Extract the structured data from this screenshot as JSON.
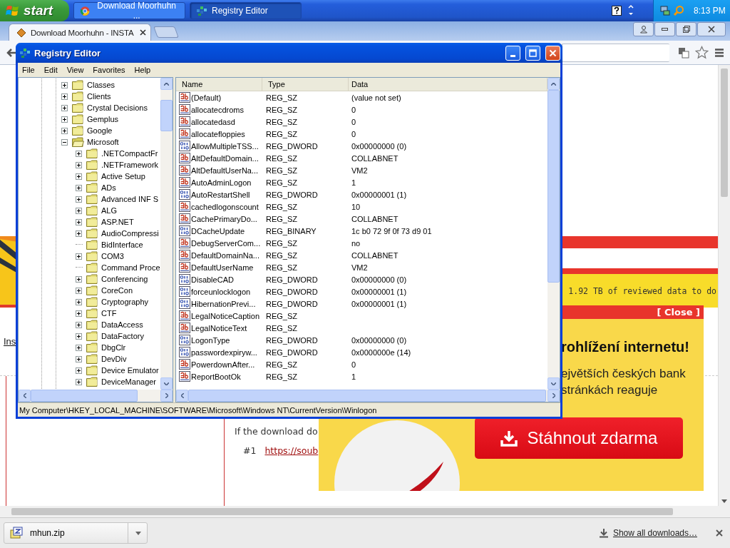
{
  "taskbar": {
    "start_label": "start",
    "tasks": [
      {
        "label": "Download Moorhuhn ...",
        "kind": "browser",
        "selected": false
      },
      {
        "label": "Registry Editor",
        "kind": "registry",
        "selected": true
      }
    ],
    "clock": "8:13 PM"
  },
  "browser": {
    "tab": {
      "title": "Download Moorhuhn - INSTA"
    },
    "page": {
      "banner_text": "1.92 TB of reviewed data to do",
      "side_link": "Ins",
      "download_text": "If the download do",
      "mirror_index": "#1",
      "mirror_link": "https://soub"
    },
    "ad": {
      "close": "[ Close ]",
      "heading": "rohlížení internetu!",
      "body_lines": [
        "ejvětších českých bank",
        "stránkách reaguje"
      ],
      "button": "Stáhnout zdarma"
    },
    "downloads": {
      "file": "mhun.zip",
      "show_all": "Show all downloads…"
    }
  },
  "registry": {
    "title": "Registry Editor",
    "menu": [
      "File",
      "Edit",
      "View",
      "Favorites",
      "Help"
    ],
    "tree": [
      {
        "label": "Classes",
        "leaf": false,
        "expanded": false
      },
      {
        "label": "Clients",
        "leaf": false,
        "expanded": false
      },
      {
        "label": "Crystal Decisions",
        "leaf": false,
        "expanded": false
      },
      {
        "label": "Gemplus",
        "leaf": false,
        "expanded": false
      },
      {
        "label": "Google",
        "leaf": false,
        "expanded": false
      },
      {
        "label": "Microsoft",
        "leaf": false,
        "expanded": true,
        "children": [
          {
            "label": ".NETCompactFr",
            "leaf": false,
            "expanded": false
          },
          {
            "label": ".NETFramework",
            "leaf": false,
            "expanded": false
          },
          {
            "label": "Active Setup",
            "leaf": false,
            "expanded": false
          },
          {
            "label": "ADs",
            "leaf": false,
            "expanded": false
          },
          {
            "label": "Advanced INF S",
            "leaf": false,
            "expanded": false
          },
          {
            "label": "ALG",
            "leaf": false,
            "expanded": false
          },
          {
            "label": "ASP.NET",
            "leaf": false,
            "expanded": false
          },
          {
            "label": "AudioCompressi",
            "leaf": false,
            "expanded": false
          },
          {
            "label": "BidInterface",
            "leaf": true
          },
          {
            "label": "COM3",
            "leaf": false,
            "expanded": false
          },
          {
            "label": "Command Proce",
            "leaf": true
          },
          {
            "label": "Conferencing",
            "leaf": false,
            "expanded": false
          },
          {
            "label": "CoreCon",
            "leaf": false,
            "expanded": false
          },
          {
            "label": "Cryptography",
            "leaf": false,
            "expanded": false
          },
          {
            "label": "CTF",
            "leaf": false,
            "expanded": false
          },
          {
            "label": "DataAccess",
            "leaf": false,
            "expanded": false
          },
          {
            "label": "DataFactory",
            "leaf": false,
            "expanded": false
          },
          {
            "label": "DbgClr",
            "leaf": false,
            "expanded": false
          },
          {
            "label": "DevDiv",
            "leaf": false,
            "expanded": false
          },
          {
            "label": "Device Emulator",
            "leaf": false,
            "expanded": false
          },
          {
            "label": "DeviceManager",
            "leaf": false,
            "expanded": false
          }
        ]
      }
    ],
    "columns": [
      "Name",
      "Type",
      "Data"
    ],
    "values": [
      {
        "kind": "string",
        "name": "(Default)",
        "type": "REG_SZ",
        "data": "(value not set)"
      },
      {
        "kind": "string",
        "name": "allocatecdroms",
        "type": "REG_SZ",
        "data": "0"
      },
      {
        "kind": "string",
        "name": "allocatedasd",
        "type": "REG_SZ",
        "data": "0"
      },
      {
        "kind": "string",
        "name": "allocatefloppies",
        "type": "REG_SZ",
        "data": "0"
      },
      {
        "kind": "binary",
        "name": "AllowMultipleTSS...",
        "type": "REG_DWORD",
        "data": "0x00000000 (0)"
      },
      {
        "kind": "string",
        "name": "AltDefaultDomain...",
        "type": "REG_SZ",
        "data": "COLLABNET"
      },
      {
        "kind": "string",
        "name": "AltDefaultUserNa...",
        "type": "REG_SZ",
        "data": "VM2"
      },
      {
        "kind": "string",
        "name": "AutoAdminLogon",
        "type": "REG_SZ",
        "data": "1"
      },
      {
        "kind": "binary",
        "name": "AutoRestartShell",
        "type": "REG_DWORD",
        "data": "0x00000001 (1)"
      },
      {
        "kind": "string",
        "name": "cachedlogonscount",
        "type": "REG_SZ",
        "data": "10"
      },
      {
        "kind": "string",
        "name": "CachePrimaryDo...",
        "type": "REG_SZ",
        "data": "COLLABNET"
      },
      {
        "kind": "binary",
        "name": "DCacheUpdate",
        "type": "REG_BINARY",
        "data": "1c b0 72 9f 0f 73 d9 01"
      },
      {
        "kind": "string",
        "name": "DebugServerCom...",
        "type": "REG_SZ",
        "data": "no"
      },
      {
        "kind": "string",
        "name": "DefaultDomainNa...",
        "type": "REG_SZ",
        "data": "COLLABNET"
      },
      {
        "kind": "string",
        "name": "DefaultUserName",
        "type": "REG_SZ",
        "data": "VM2"
      },
      {
        "kind": "binary",
        "name": "DisableCAD",
        "type": "REG_DWORD",
        "data": "0x00000000 (0)"
      },
      {
        "kind": "binary",
        "name": "forceunlocklogon",
        "type": "REG_DWORD",
        "data": "0x00000001 (1)"
      },
      {
        "kind": "binary",
        "name": "HibernationPrevi...",
        "type": "REG_DWORD",
        "data": "0x00000001 (1)"
      },
      {
        "kind": "string",
        "name": "LegalNoticeCaption",
        "type": "REG_SZ"
      },
      {
        "kind": "string",
        "name": "LegalNoticeText",
        "type": "REG_SZ"
      },
      {
        "kind": "binary",
        "name": "LogonType",
        "type": "REG_DWORD",
        "data": "0x00000000 (0)"
      },
      {
        "kind": "binary",
        "name": "passwordexpiryw...",
        "type": "REG_DWORD",
        "data": "0x0000000e (14)"
      },
      {
        "kind": "string",
        "name": "PowerdownAfter...",
        "type": "REG_SZ",
        "data": "0"
      },
      {
        "kind": "string",
        "name": "ReportBootOk",
        "type": "REG_SZ",
        "data": "1"
      }
    ],
    "status": "My Computer\\HKEY_LOCAL_MACHINE\\SOFTWARE\\Microsoft\\Windows NT\\CurrentVersion\\Winlogon"
  }
}
